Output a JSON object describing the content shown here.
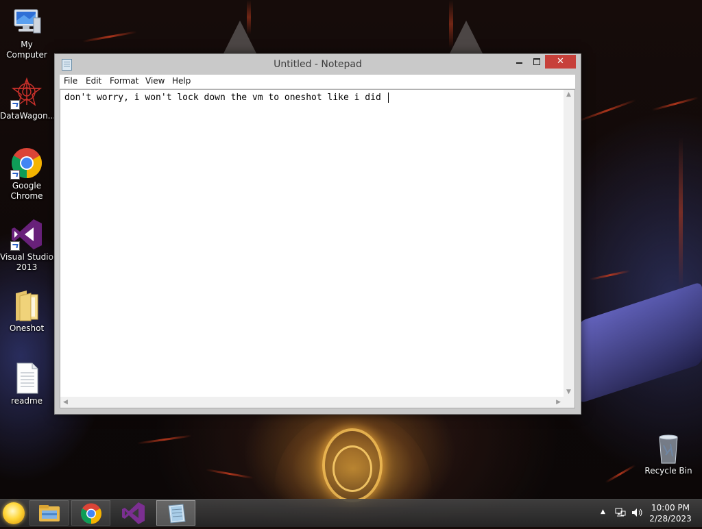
{
  "desktop": {
    "icons": [
      {
        "label": "My Computer",
        "icon": "my-computer-icon"
      },
      {
        "label": "DataWagon...",
        "icon": "datawagon-icon"
      },
      {
        "label": "Google Chrome",
        "icon": "chrome-icon"
      },
      {
        "label": "Visual Studio 2013",
        "icon": "visual-studio-icon"
      },
      {
        "label": "Oneshot",
        "icon": "folder-icon"
      },
      {
        "label": "readme",
        "icon": "text-file-icon"
      },
      {
        "label": "Recycle Bin",
        "icon": "recycle-bin-icon"
      }
    ]
  },
  "notepad": {
    "title": "Untitled - Notepad",
    "buttons": {
      "minimize": "minimize-icon",
      "maximize": "maximize-icon",
      "close": "✕"
    },
    "menu": [
      "File",
      "Edit",
      "Format",
      "View",
      "Help"
    ],
    "content": "don't worry, i won't lock down the vm to oneshot like i did "
  },
  "taskbar": {
    "start_icon": "start-orb-icon",
    "items": [
      {
        "icon": "file-explorer-icon",
        "active": false
      },
      {
        "icon": "chrome-icon",
        "active": false
      },
      {
        "icon": "visual-studio-icon",
        "active": false
      },
      {
        "icon": "notepad-icon",
        "active": true
      }
    ],
    "tray": {
      "icons": [
        "show-hidden-icons-arrow-icon",
        "network-icon",
        "volume-icon"
      ],
      "time": "10:00 PM",
      "date": "2/28/2023"
    }
  },
  "colors": {
    "close_button": "#c7403a",
    "window_frame": "#c9c9c9",
    "taskbar": "#3a3a3a"
  }
}
